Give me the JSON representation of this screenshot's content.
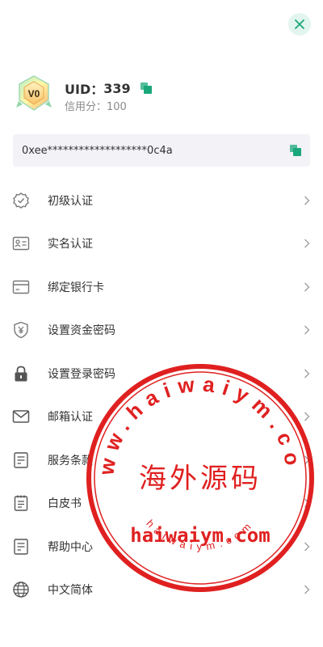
{
  "header": {
    "close_icon": "close-icon"
  },
  "profile": {
    "badge_text": "V0",
    "uid_label": "UID：",
    "uid_value": "339",
    "credit_label": "信用分：",
    "credit_value": "100"
  },
  "wallet": {
    "address": "0xee*******************0c4a"
  },
  "menu": {
    "items": [
      {
        "label": "初级认证",
        "icon": "verified-shield-icon"
      },
      {
        "label": "实名认证",
        "icon": "id-card-icon"
      },
      {
        "label": "绑定银行卡",
        "icon": "bank-card-icon"
      },
      {
        "label": "设置资金密码",
        "icon": "yen-shield-icon"
      },
      {
        "label": "设置登录密码",
        "icon": "lock-icon"
      },
      {
        "label": "邮箱认证",
        "icon": "mail-icon"
      },
      {
        "label": "服务条款",
        "icon": "document-icon"
      },
      {
        "label": "白皮书",
        "icon": "notebook-icon"
      },
      {
        "label": "帮助中心",
        "icon": "help-document-icon"
      },
      {
        "label": "中文简体",
        "icon": "globe-icon"
      }
    ]
  },
  "watermark": {
    "arc_top": "www.haiwaiym.com",
    "center_text": "海外源码",
    "domain_text": "haiwaiym.com",
    "arc_bottom": "haiwaiym.com",
    "color": "#e02020"
  },
  "colors": {
    "accent": "#1aa77a",
    "close_bg": "#e3f5ef",
    "address_bg": "#f2f2f7",
    "icon_gray": "#666666"
  }
}
